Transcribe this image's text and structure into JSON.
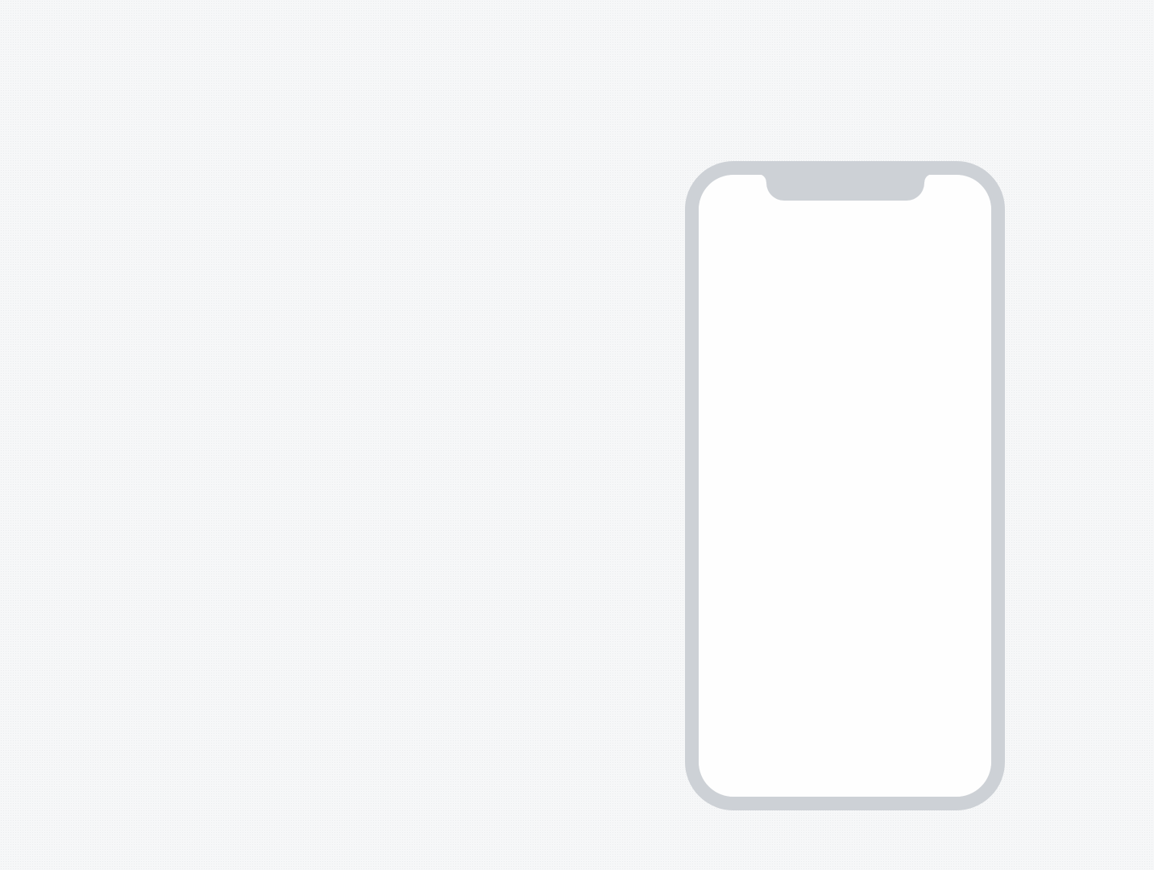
{
  "colors": {
    "background": "#f6f7f8",
    "device_frame": "#cdd1d6",
    "screen": "#fefefe"
  },
  "device": {
    "type": "phone-outline",
    "notch": true
  }
}
